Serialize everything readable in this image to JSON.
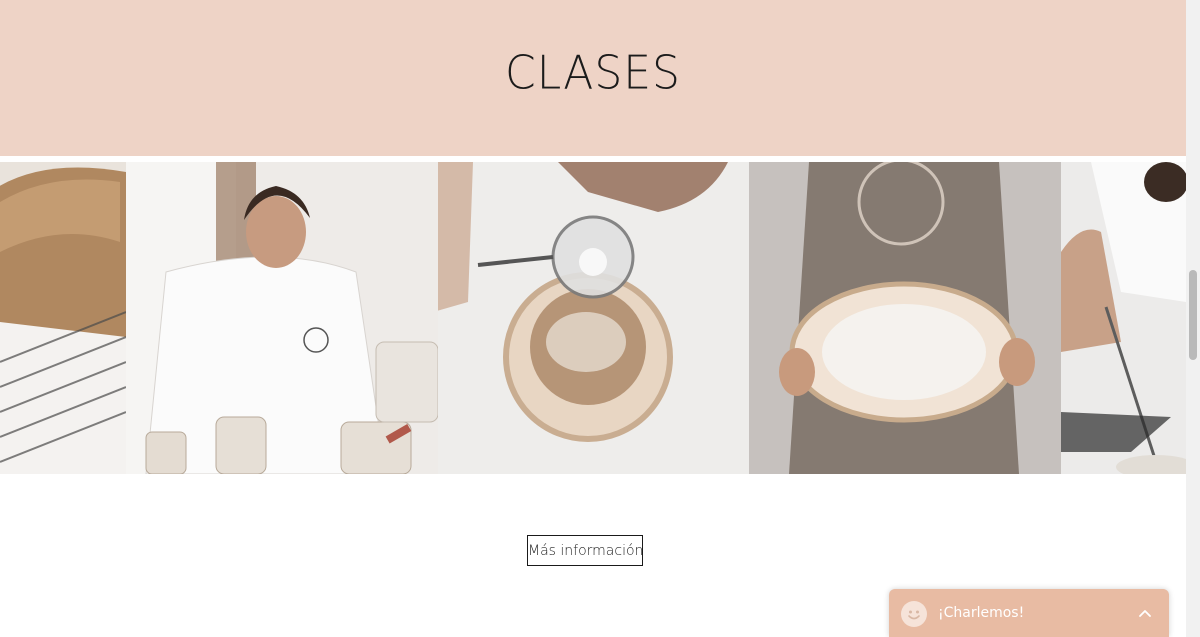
{
  "section": {
    "title": "CLASES"
  },
  "gallery": {
    "images": [
      {
        "name": "photo-bread-loaf"
      },
      {
        "name": "photo-chef-woman"
      },
      {
        "name": "photo-sifting-flour"
      },
      {
        "name": "photo-proofing-basket"
      },
      {
        "name": "photo-scoring-dough"
      }
    ]
  },
  "cta": {
    "label": "Más información"
  },
  "chat": {
    "label": "¡Charlemos!",
    "icon": "smiley-icon",
    "toggle_icon": "chevron-up-icon"
  },
  "colors": {
    "header_band": "#eed3c6",
    "chat_bg": "#e8bba3",
    "text": "#1b1b1b"
  }
}
